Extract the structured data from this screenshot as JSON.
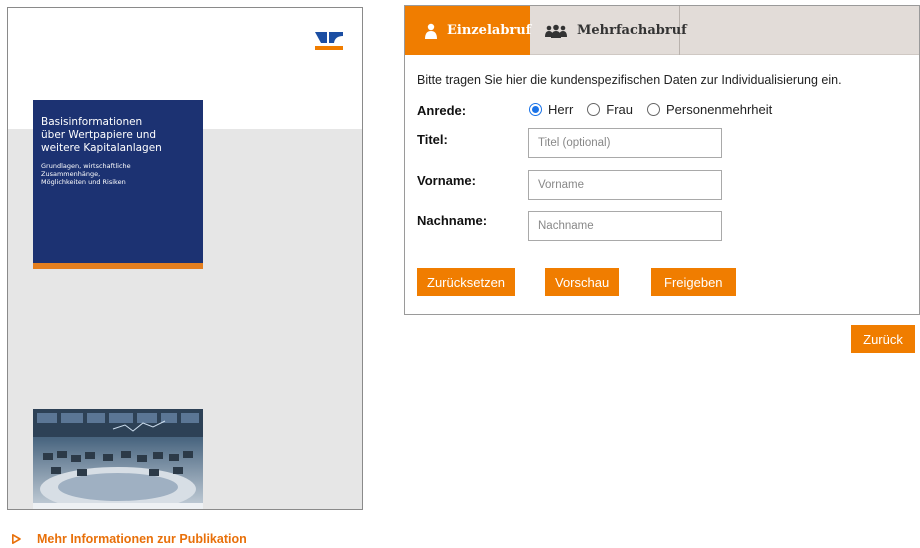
{
  "cover": {
    "title": "Basisinformationen\nüber Wertpapiere und\nweitere Kapitalanlagen",
    "subtitle": "Grundlagen, wirtschaftliche\nZusammenhänge,\nMöglichkeiten und Risiken",
    "colors": {
      "title_bg": "#1c3272",
      "accent": "#e47f1f",
      "logo": "#1b4ea3"
    }
  },
  "tabs": [
    {
      "label": "Einzelabruf",
      "icon": "person-icon",
      "active": true
    },
    {
      "label": "Mehrfachabruf",
      "icon": "group-icon",
      "active": false
    }
  ],
  "form": {
    "intro": "Bitte tragen Sie hier die kundenspezifischen Daten zur Individualisierung ein.",
    "anrede": {
      "label": "Anrede:",
      "options": [
        "Herr",
        "Frau",
        "Personenmehrheit"
      ],
      "selected": "Herr"
    },
    "titel": {
      "label": "Titel:",
      "placeholder": "Titel (optional)",
      "value": ""
    },
    "vorname": {
      "label": "Vorname:",
      "placeholder": "Vorname",
      "value": ""
    },
    "nachname": {
      "label": "Nachname:",
      "placeholder": "Nachname",
      "value": ""
    },
    "buttons": {
      "reset": "Zurücksetzen",
      "preview": "Vorschau",
      "release": "Freigeben"
    }
  },
  "back_button": "Zurück",
  "more_link": {
    "label": "Mehr Informationen zur Publikation",
    "icon": "triangle-right-icon"
  },
  "colors": {
    "accent": "#f07d00",
    "tabbar_bg": "#e2dcd8",
    "link": "#e8700a",
    "radio_checked": "#1a73e8"
  }
}
